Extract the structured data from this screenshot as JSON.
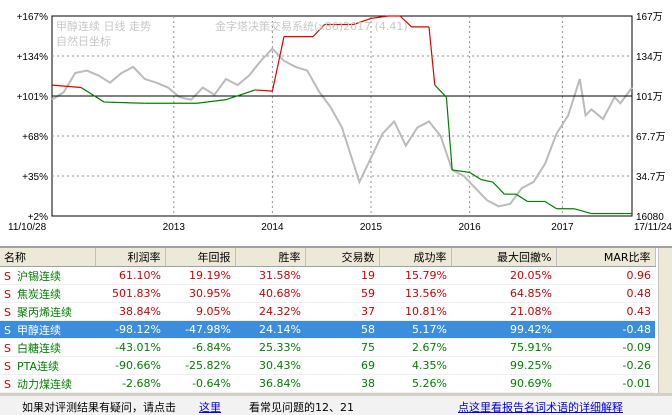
{
  "chart": {
    "title_lines": [
      "甲醇连续 日线 走势",
      "自然日坐标"
    ],
    "watermark": "金字塔决策交易系统(x86)2017 (4.41)",
    "left_axis": [
      "+167%",
      "+134%",
      "+101%",
      "+68%",
      "+35%",
      "+2%"
    ],
    "right_axis": [
      "167万",
      "134万",
      "101万",
      "67.7万",
      "34.7万",
      "16080"
    ],
    "x_axis": [
      "11/10/28",
      "2013",
      "2014",
      "2015",
      "2016",
      "2017",
      "17/11/24"
    ],
    "colors": {
      "up": "#e00000",
      "down": "#008000",
      "price": "#bbbbbb",
      "baseline": "#000000",
      "grid": "#9090a0"
    },
    "equity_curve": [
      [
        0,
        110
      ],
      [
        0.05,
        108
      ],
      [
        0.09,
        96
      ],
      [
        0.16,
        95
      ],
      [
        0.25,
        95
      ],
      [
        0.3,
        98
      ],
      [
        0.35,
        106
      ],
      [
        0.38,
        105
      ],
      [
        0.4,
        150
      ],
      [
        0.45,
        150
      ],
      [
        0.47,
        160
      ],
      [
        0.52,
        160
      ],
      [
        0.55,
        165
      ],
      [
        0.58,
        167
      ],
      [
        0.6,
        167
      ],
      [
        0.62,
        158
      ],
      [
        0.65,
        158
      ],
      [
        0.66,
        110
      ],
      [
        0.68,
        100
      ],
      [
        0.69,
        40
      ],
      [
        0.72,
        38
      ],
      [
        0.74,
        32
      ],
      [
        0.76,
        30
      ],
      [
        0.78,
        20
      ],
      [
        0.8,
        20
      ],
      [
        0.82,
        14
      ],
      [
        0.85,
        14
      ],
      [
        0.87,
        8
      ],
      [
        0.9,
        8
      ],
      [
        0.93,
        4
      ],
      [
        0.97,
        4
      ],
      [
        1.0,
        4
      ]
    ],
    "price_curve": [
      [
        0,
        98
      ],
      [
        0.02,
        104
      ],
      [
        0.04,
        120
      ],
      [
        0.06,
        122
      ],
      [
        0.08,
        118
      ],
      [
        0.1,
        112
      ],
      [
        0.12,
        120
      ],
      [
        0.14,
        125
      ],
      [
        0.16,
        115
      ],
      [
        0.18,
        112
      ],
      [
        0.2,
        108
      ],
      [
        0.22,
        100
      ],
      [
        0.24,
        98
      ],
      [
        0.26,
        108
      ],
      [
        0.28,
        102
      ],
      [
        0.3,
        115
      ],
      [
        0.32,
        110
      ],
      [
        0.34,
        118
      ],
      [
        0.36,
        130
      ],
      [
        0.38,
        140
      ],
      [
        0.4,
        130
      ],
      [
        0.42,
        125
      ],
      [
        0.44,
        122
      ],
      [
        0.46,
        105
      ],
      [
        0.48,
        92
      ],
      [
        0.5,
        75
      ],
      [
        0.52,
        45
      ],
      [
        0.53,
        30
      ],
      [
        0.55,
        50
      ],
      [
        0.57,
        70
      ],
      [
        0.59,
        80
      ],
      [
        0.61,
        60
      ],
      [
        0.63,
        75
      ],
      [
        0.65,
        80
      ],
      [
        0.67,
        68
      ],
      [
        0.69,
        40
      ],
      [
        0.71,
        35
      ],
      [
        0.73,
        25
      ],
      [
        0.75,
        15
      ],
      [
        0.77,
        10
      ],
      [
        0.79,
        12
      ],
      [
        0.81,
        25
      ],
      [
        0.83,
        30
      ],
      [
        0.85,
        45
      ],
      [
        0.87,
        70
      ],
      [
        0.89,
        85
      ],
      [
        0.9,
        100
      ],
      [
        0.91,
        115
      ],
      [
        0.92,
        85
      ],
      [
        0.93,
        90
      ],
      [
        0.95,
        82
      ],
      [
        0.97,
        100
      ],
      [
        0.98,
        95
      ],
      [
        1.0,
        108
      ]
    ]
  },
  "table": {
    "headers": [
      "名称",
      "利润率",
      "年回报",
      "胜率",
      "交易数",
      "成功率",
      "最大回撤%",
      "MAR比率"
    ],
    "rows": [
      {
        "name": "沪锡连续",
        "profit": "61.10%",
        "annual": "19.19%",
        "win": "31.58%",
        "trades": "19",
        "success": "15.79%",
        "drawdown": "20.05%",
        "mar": "0.96",
        "sign": "pos",
        "selected": false
      },
      {
        "name": "焦炭连续",
        "profit": "501.83%",
        "annual": "30.95%",
        "win": "40.68%",
        "trades": "59",
        "success": "13.56%",
        "drawdown": "64.85%",
        "mar": "0.48",
        "sign": "pos",
        "selected": false
      },
      {
        "name": "聚丙烯连续",
        "profit": "38.84%",
        "annual": "9.05%",
        "win": "24.32%",
        "trades": "37",
        "success": "10.81%",
        "drawdown": "21.08%",
        "mar": "0.43",
        "sign": "pos",
        "selected": false
      },
      {
        "name": "甲醇连续",
        "profit": "-98.12%",
        "annual": "-47.98%",
        "win": "24.14%",
        "trades": "58",
        "success": "5.17%",
        "drawdown": "99.42%",
        "mar": "-0.48",
        "sign": "neg",
        "selected": true
      },
      {
        "name": "白糖连续",
        "profit": "-43.01%",
        "annual": "-6.84%",
        "win": "25.33%",
        "trades": "75",
        "success": "2.67%",
        "drawdown": "75.91%",
        "mar": "-0.09",
        "sign": "neg",
        "selected": false
      },
      {
        "name": "PTA连续",
        "profit": "-90.66%",
        "annual": "-25.82%",
        "win": "30.43%",
        "trades": "69",
        "success": "4.35%",
        "drawdown": "99.25%",
        "mar": "-0.26",
        "sign": "neg",
        "selected": false
      },
      {
        "name": "动力煤连续",
        "profit": "-2.68%",
        "annual": "-0.64%",
        "win": "36.84%",
        "trades": "38",
        "success": "5.26%",
        "drawdown": "90.69%",
        "mar": "-0.01",
        "sign": "neg",
        "selected": false
      }
    ],
    "row_marker": "S"
  },
  "footer": {
    "prompt": "如果对评测结果有疑问，请点击",
    "link1": "这里",
    "faq": "看常见问题的12、21",
    "link2": "点这里看报告名词术语的详细解释"
  }
}
